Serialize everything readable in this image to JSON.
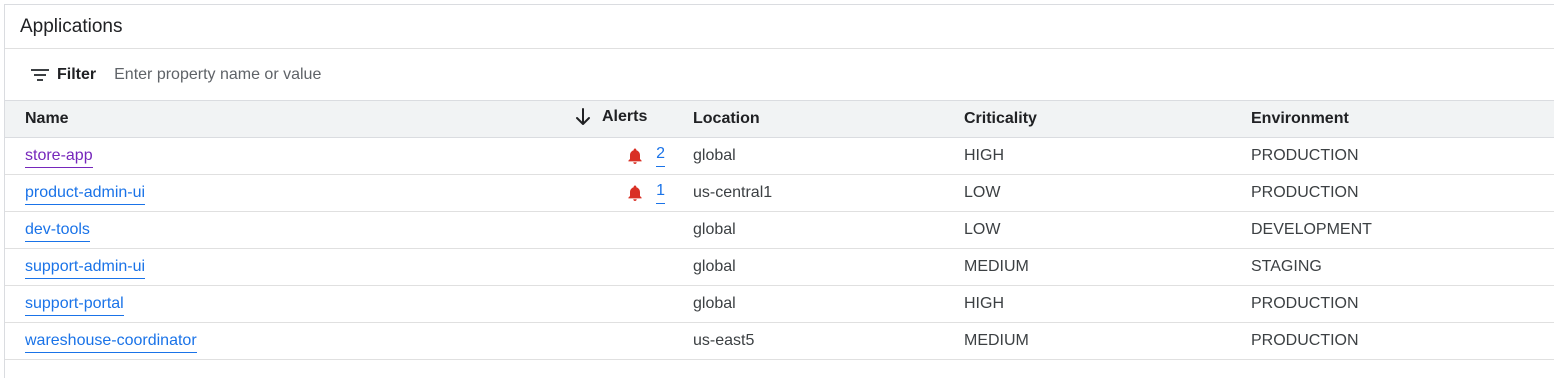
{
  "panel": {
    "title": "Applications"
  },
  "filter": {
    "label": "Filter",
    "placeholder": "Enter property name or value",
    "value": ""
  },
  "table": {
    "columns": {
      "name": "Name",
      "alerts": "Alerts",
      "location": "Location",
      "criticality": "Criticality",
      "environment": "Environment"
    },
    "sort": {
      "column": "alerts",
      "direction": "descending"
    },
    "rows": [
      {
        "name": "store-app",
        "visited": true,
        "alerts": "2",
        "location": "global",
        "criticality": "HIGH",
        "environment": "PRODUCTION"
      },
      {
        "name": "product-admin-ui",
        "visited": false,
        "alerts": "1",
        "location": "us-central1",
        "criticality": "LOW",
        "environment": "PRODUCTION"
      },
      {
        "name": "dev-tools",
        "visited": false,
        "alerts": "",
        "location": "global",
        "criticality": "LOW",
        "environment": "DEVELOPMENT"
      },
      {
        "name": "support-admin-ui",
        "visited": false,
        "alerts": "",
        "location": "global",
        "criticality": "MEDIUM",
        "environment": "STAGING"
      },
      {
        "name": "support-portal",
        "visited": false,
        "alerts": "",
        "location": "global",
        "criticality": "HIGH",
        "environment": "PRODUCTION"
      },
      {
        "name": "wareshouse-coordinator",
        "visited": false,
        "alerts": "",
        "location": "us-east5",
        "criticality": "MEDIUM",
        "environment": "PRODUCTION"
      }
    ]
  },
  "icons": {
    "filter": "filter-list-icon",
    "sort": "arrow-down-icon",
    "alert": "bell-icon"
  },
  "colors": {
    "link": "#1a73e8",
    "visited_link": "#7627bb",
    "alert_bell": "#d93025",
    "header_bg": "#f1f3f4"
  }
}
